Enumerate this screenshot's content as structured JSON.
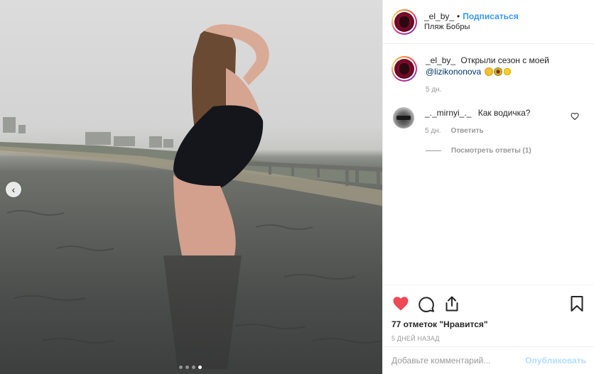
{
  "header": {
    "username": "_el_by_",
    "separator": "•",
    "follow_label": "Подписаться",
    "location": "Пляж Бобры"
  },
  "caption": {
    "username": "_el_by_",
    "text": "Открыли сезон с моей",
    "mention": "@lizikononova",
    "emojis": [
      "grinning-face-icon",
      "sunflower-icon",
      "sun-icon"
    ],
    "time": "5 дн."
  },
  "comment": {
    "username": "_._mirnyi_._",
    "text": "Как водичка?",
    "time": "5 дн.",
    "reply_label": "Ответить",
    "view_replies": "Посмотреть ответы (1)"
  },
  "actions": {
    "likes": "77 отметок \"Нравится\"",
    "date": "5 ДНЕЙ НАЗАД"
  },
  "add_comment": {
    "placeholder": "Добавьте комментарий...",
    "publish_label": "Опубликовать"
  },
  "carousel": {
    "slide_count": 4,
    "active_index": 3
  },
  "colors": {
    "accent": "#3897f0",
    "like_red": "#ed4956",
    "muted": "#999999",
    "publish_disabled": "#b2dffc"
  }
}
